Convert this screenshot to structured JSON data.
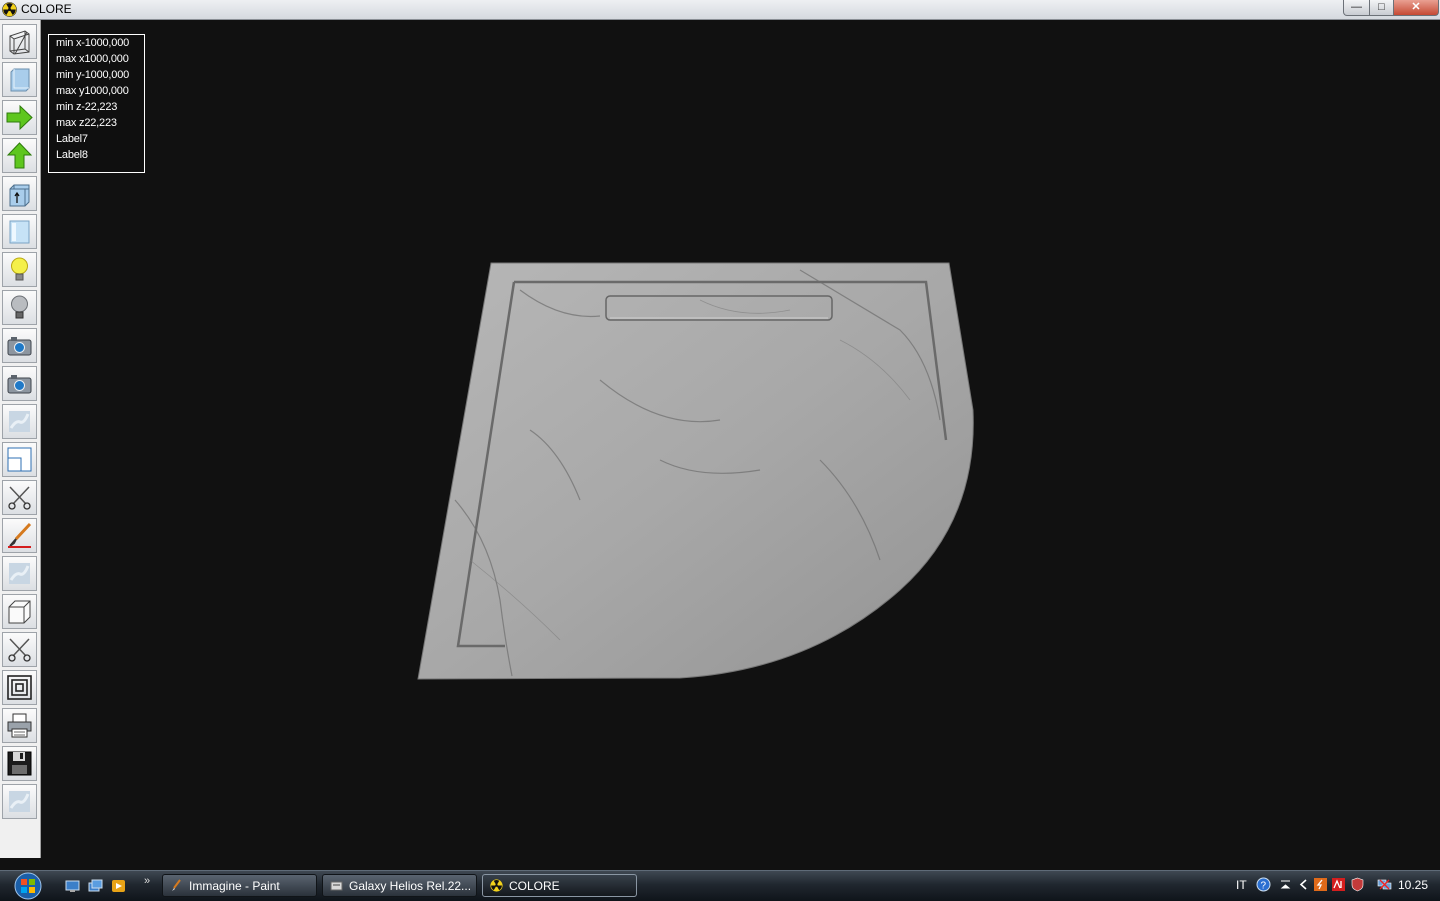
{
  "window": {
    "title": "COLORE",
    "minimize_label": "—",
    "maximize_label": "□",
    "close_label": "✕"
  },
  "toolbar": {
    "tools": [
      {
        "name": "wireframe-icon"
      },
      {
        "name": "solid-block-icon"
      },
      {
        "name": "arrow-right-icon"
      },
      {
        "name": "arrow-up-icon"
      },
      {
        "name": "extrude-up-icon"
      },
      {
        "name": "glass-block-icon"
      },
      {
        "name": "light-on-icon"
      },
      {
        "name": "light-off-icon"
      },
      {
        "name": "camera-icon"
      },
      {
        "name": "camera-2-icon"
      },
      {
        "name": "texture-icon"
      },
      {
        "name": "view-frame-icon"
      },
      {
        "name": "scissors-icon"
      },
      {
        "name": "paintbrush-icon"
      },
      {
        "name": "texture-2-icon"
      },
      {
        "name": "box-icon"
      },
      {
        "name": "scissors-2-icon"
      },
      {
        "name": "concentric-squares-icon"
      },
      {
        "name": "printer-icon"
      },
      {
        "name": "floppy-disk-icon"
      },
      {
        "name": "texture-3-icon"
      }
    ]
  },
  "info": {
    "min_x": "min x-1000,000",
    "max_x": "max x1000,000",
    "min_y": "min y-1000,000",
    "max_y": "max y1000,000",
    "min_z": "min z-22,223",
    "max_z": "max z22,223",
    "label7": "Label7",
    "label8": "Label8"
  },
  "taskbar": {
    "quick_launch_more": "»",
    "tasks": [
      {
        "label": "Immagine - Paint",
        "icon": "paint-icon"
      },
      {
        "label": "Galaxy Helios  Rel.22...",
        "icon": "galaxy-icon"
      },
      {
        "label": "COLORE",
        "icon": "radiation-icon"
      }
    ],
    "tray": {
      "language": "IT",
      "clock": "10.25"
    }
  }
}
